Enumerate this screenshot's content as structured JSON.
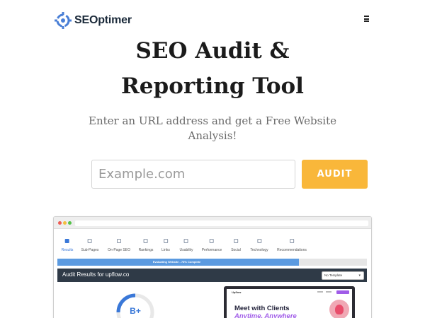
{
  "header": {
    "brand": "SEOptimer",
    "logo_icon": "seoptimer-logo-icon",
    "menu_icon": "hamburger-menu-icon"
  },
  "hero": {
    "title_line1": "SEO Audit &",
    "title_line2": "Reporting Tool",
    "subtitle": "Enter an URL address and get a Free Website Analysis!"
  },
  "search": {
    "placeholder": "Example.com",
    "value": "",
    "button_label": "AUDIT"
  },
  "mockup": {
    "tabs": [
      {
        "label": "Results",
        "icon": "grid-icon",
        "active": true
      },
      {
        "label": "Sub-Pages",
        "icon": "link-icon",
        "active": false
      },
      {
        "label": "On-Page SEO",
        "icon": "target-icon",
        "active": false
      },
      {
        "label": "Rankings",
        "icon": "rankings-icon",
        "active": false
      },
      {
        "label": "Links",
        "icon": "chain-icon",
        "active": false
      },
      {
        "label": "Usability",
        "icon": "mobile-icon",
        "active": false
      },
      {
        "label": "Performance",
        "icon": "bars-icon",
        "active": false
      },
      {
        "label": "Social",
        "icon": "social-icon",
        "active": false
      },
      {
        "label": "Technology",
        "icon": "gears-icon",
        "active": false
      },
      {
        "label": "Recommendations",
        "icon": "clipboard-icon",
        "active": false
      }
    ],
    "progress": {
      "label": "Evaluating Website - 78% Complete",
      "percent": 78
    },
    "results_title": "Audit Results for upflow.co",
    "template_select": "No Template",
    "grade": "B+",
    "preview": {
      "logo": "Upflow",
      "headline1": "Meet with Clients",
      "headline2": "Anytime, Anywhere"
    },
    "colors": {
      "accent": "#3a78d8",
      "audit_button": "#f9b73a",
      "results_bar": "#2f3a47",
      "preview_purple": "#a05ce8"
    }
  }
}
